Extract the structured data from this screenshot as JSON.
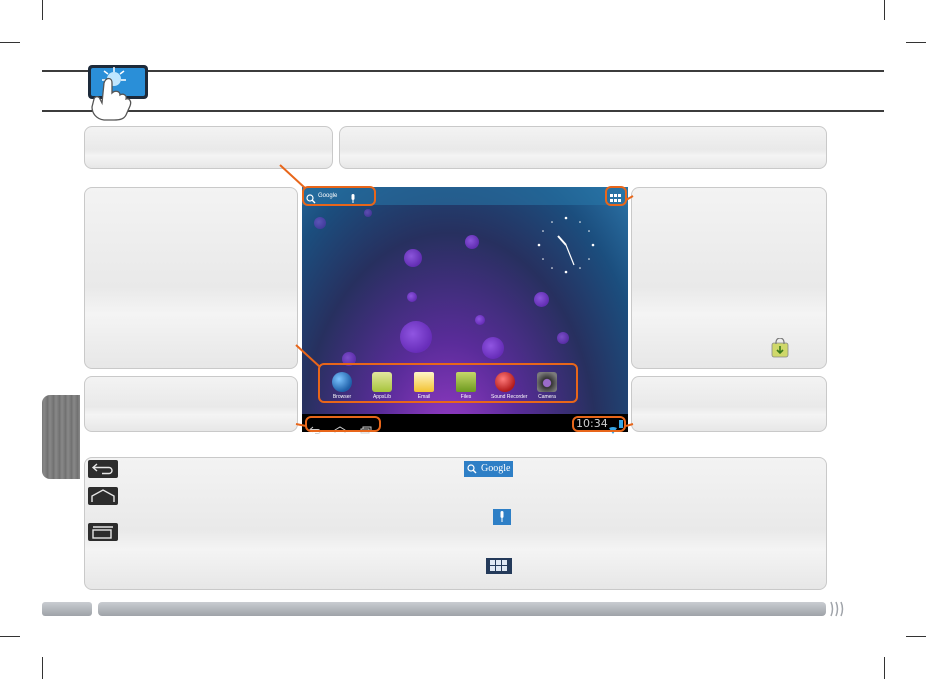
{
  "screen": {
    "search_label": "Google",
    "clock_time": "10:34",
    "apps": [
      {
        "label": "Browser",
        "icon": "globe-icon",
        "color": "#2f78c4"
      },
      {
        "label": "AppsLib",
        "icon": "shopping-bag-icon",
        "color": "#8fbf2a"
      },
      {
        "label": "Email",
        "icon": "envelope-icon",
        "color": "#f2c230"
      },
      {
        "label": "Files",
        "icon": "folder-icon",
        "color": "#8bb82a"
      },
      {
        "label": "Sound Recorder",
        "icon": "microphone-icon",
        "color": "#d22b2b"
      },
      {
        "label": "Camera",
        "icon": "camera-icon",
        "color": "#6a6a6a"
      }
    ]
  },
  "legend": {
    "google_label": "Google"
  },
  "colors": {
    "callout_orange": "#e8661a",
    "panel_grey": "#ececec",
    "rule": "#3c3c3c"
  }
}
